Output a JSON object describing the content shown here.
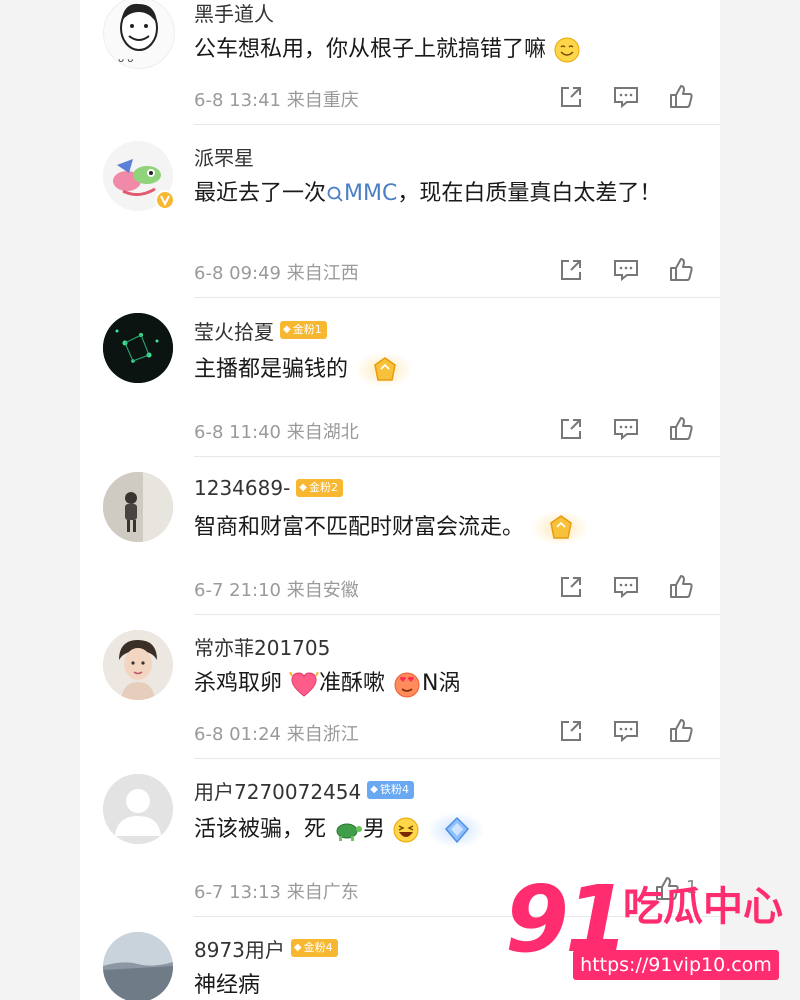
{
  "comments": [
    {
      "username": "黑手道人",
      "badge": "",
      "text": "公车想私用，你从根子上就搞错了嘛",
      "time": "6-8 13:41",
      "location": "来自重庆",
      "likes": ""
    },
    {
      "username": "派罘星",
      "badge": "",
      "text_before": "最近去了一次",
      "text_link": "MMC",
      "text_after": "，现在白质量真白太差了！",
      "time": "6-8 09:49",
      "location": "来自江西",
      "likes": ""
    },
    {
      "username": "莹火拾夏",
      "badge": "金粉1",
      "text": "主播都是骗钱的",
      "time": "6-8 11:40",
      "location": "来自湖北",
      "likes": ""
    },
    {
      "username": "1234689-",
      "badge": "金粉2",
      "text": "智商和财富不匹配时财富会流走。",
      "time": "6-7 21:10",
      "location": "来自安徽",
      "likes": ""
    },
    {
      "username": "常亦菲201705",
      "badge": "",
      "text_a": "杀鸡取卵",
      "text_b": "准酥嗽",
      "text_c": "N涡",
      "time": "6-8 01:24",
      "location": "来自浙江",
      "likes": ""
    },
    {
      "username": "用户7270072454",
      "badge": "铁粉4",
      "text_a": "活该被骗，死",
      "text_b": "男",
      "time": "6-7 13:13",
      "location": "来自广东",
      "likes": "1"
    },
    {
      "username": "8973用户",
      "badge": "金粉4",
      "text": "神经病",
      "time": "",
      "location": "",
      "likes": ""
    }
  ],
  "watermark": {
    "brand_num": "91",
    "brand_text": "吃瓜中心",
    "url": "https://91vip10.com"
  },
  "colors": {
    "gold_badge": "#f7b731",
    "iron_badge": "#6aa8f2",
    "watermark_pink": "#ff2d6f",
    "link_blue": "#4a7fc4"
  },
  "icons": [
    "share-icon",
    "comment-icon",
    "like-icon",
    "verified-icon",
    "search-icon"
  ]
}
